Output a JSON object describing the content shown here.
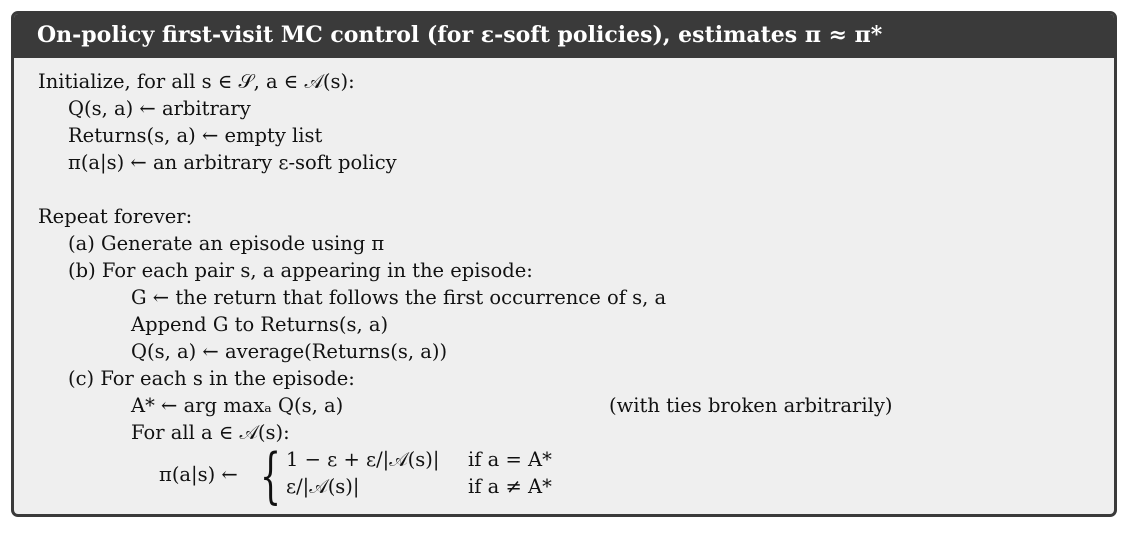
{
  "algorithm": {
    "title": "On-policy first-visit MC control (for ε-soft policies), estimates π ≈ π*",
    "lines": [
      "Initialize, for all s ∈ 𝒮, a ∈ 𝒜(s):",
      "Q(s, a) ← arbitrary",
      "Returns(s, a) ← empty list",
      "π(a|s) ← an arbitrary ε-soft policy",
      "Repeat forever:",
      "(a) Generate an episode using π",
      "(b) For each pair s, a appearing in the episode:",
      "G ← the return that follows the first occurrence of s, a",
      "Append G to Returns(s, a)",
      "Q(s, a) ← average(Returns(s, a))",
      "(c) For each s in the episode:",
      "A* ← arg maxₐ Q(s, a)",
      "For all a ∈ 𝒜(s):"
    ],
    "argmax_note": "(with ties broken arbitrarily)",
    "policy_update": {
      "lhs": "π(a|s) ←",
      "case1_value": "1 − ε + ε/|𝒜(s)|",
      "case1_condition": "if a = A*",
      "case2_value": "ε/|𝒜(s)|",
      "case2_condition": "if a ≠ A*"
    }
  }
}
